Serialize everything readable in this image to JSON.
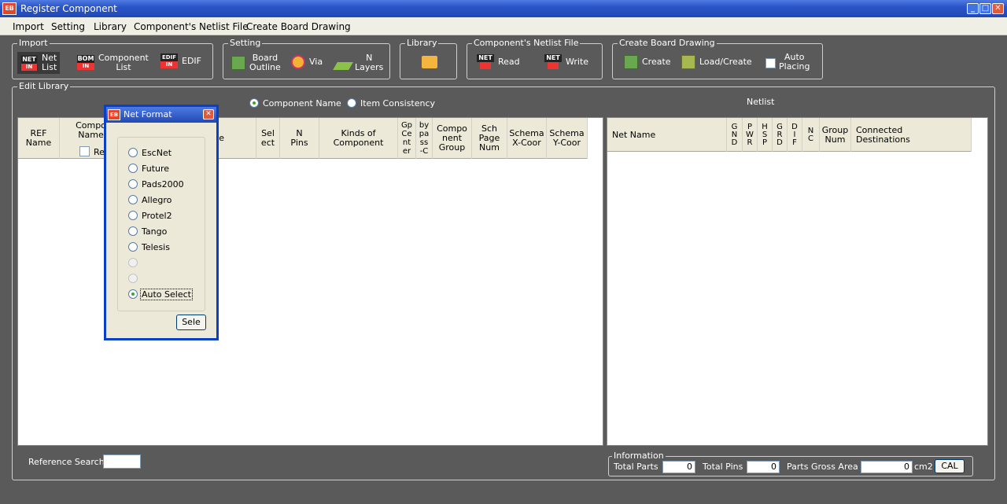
{
  "window": {
    "title": "Register Component",
    "app_icon": "EB"
  },
  "menu": [
    "Import",
    "Setting",
    "Library",
    "Component's Netlist File",
    "Create Board Drawing"
  ],
  "toolbar": {
    "import": {
      "label": "Import",
      "net_list": "Net\nList",
      "component_list": "Component\nList",
      "edif": "EDIF"
    },
    "setting": {
      "label": "Setting",
      "board_outline": "Board\nOutline",
      "via": "Via",
      "n_layers": "N\nLayers"
    },
    "library": {
      "label": "Library"
    },
    "netlist_file": {
      "label": "Component's Netlist File",
      "read": "Read",
      "write": "Write"
    },
    "create_board": {
      "label": "Create Board Drawing",
      "create": "Create",
      "load_create": "Load/Create",
      "auto_placing": "Auto\nPlacing"
    }
  },
  "edit_library": {
    "label": "Edit Library",
    "mode_component_name": "Component Name",
    "mode_item_consistency": "Item Consistency",
    "netlist_title": "Netlist",
    "columns": [
      "REF\nName",
      "Compo\nName",
      "e",
      "Sel\nect",
      "N\nPins",
      "Kinds of\nComponent",
      "Gp\nCe\nnt\ner",
      "by\npa\nss\n-C",
      "Compo\nnent\nGroup",
      "Sch\nPage\nNum",
      "Schema\nX-Coor",
      "Schema\nY-Coor"
    ],
    "re_checkbox": "Re",
    "net_columns": [
      "Net Name",
      "G\nN\nD",
      "P\nW\nR",
      "H\nS\nP",
      "G\nR\nD",
      "D\nI\nF",
      "N\nC",
      "Group\nNum",
      "Connected\nDestinations"
    ],
    "reference_search": "Reference Search"
  },
  "information": {
    "label": "Information",
    "total_parts_label": "Total Parts",
    "total_parts": "0",
    "total_pins_label": "Total Pins",
    "total_pins": "0",
    "area_label": "Parts Gross Area",
    "area": "0",
    "area_unit": "cm2",
    "cal": "CAL"
  },
  "dialog": {
    "title": "Net Format",
    "options": [
      "EscNet",
      "Future",
      "Pads2000",
      "Allegro",
      "Protel2",
      "Tango",
      "Telesis"
    ],
    "auto_select": "Auto Select",
    "select_button": "Sele"
  }
}
